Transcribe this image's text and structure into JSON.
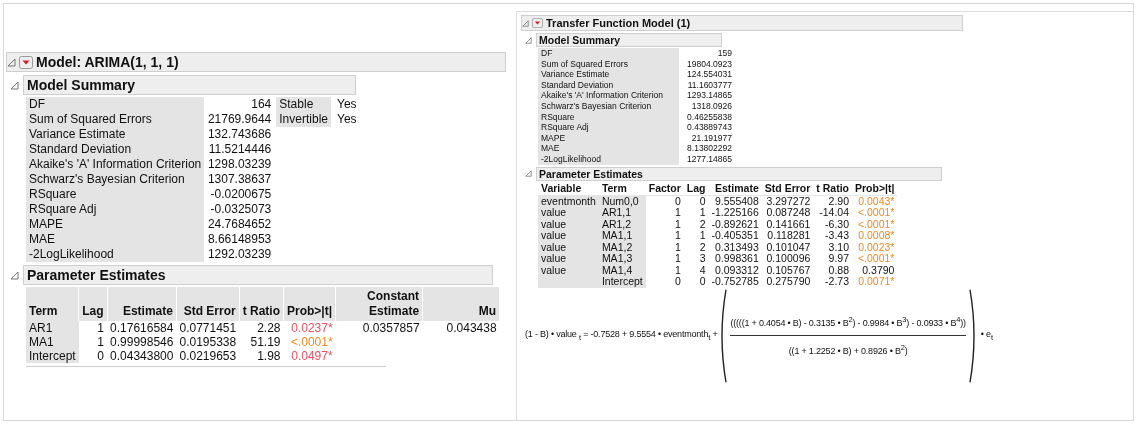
{
  "arima": {
    "title": "Model: ARIMA(1, 1, 1)",
    "summary": {
      "title": "Model Summary",
      "rows": [
        {
          "label": "DF",
          "value": "164"
        },
        {
          "label": "Sum of Squared Errors",
          "value": "21769.9644"
        },
        {
          "label": "Variance Estimate",
          "value": "132.743686"
        },
        {
          "label": "Standard Deviation",
          "value": "11.5214446"
        },
        {
          "label": "Akaike's 'A' Information Criterion",
          "value": "1298.03239"
        },
        {
          "label": "Schwarz's Bayesian Criterion",
          "value": "1307.38637"
        },
        {
          "label": "RSquare",
          "value": "-0.0200675"
        },
        {
          "label": "RSquare Adj",
          "value": "-0.0325073"
        },
        {
          "label": "MAPE",
          "value": "24.7684652"
        },
        {
          "label": "MAE",
          "value": "8.66148953"
        },
        {
          "label": "-2LogLikelihood",
          "value": "1292.03239"
        }
      ],
      "flags": [
        {
          "label": "Stable",
          "value": "Yes"
        },
        {
          "label": "Invertible",
          "value": "Yes"
        }
      ]
    },
    "params": {
      "title": "Parameter Estimates",
      "columns": [
        "Term",
        "Lag",
        "Estimate",
        "Std Error",
        "t Ratio",
        "Prob>|t|",
        "Constant Estimate",
        "Mu"
      ],
      "rows": [
        {
          "term": "AR1",
          "lag": "1",
          "estimate": "0.17616584",
          "std_error": "0.0771451",
          "t_ratio": "2.28",
          "prob": "0.0237*",
          "color": "#f04e5e",
          "constant_estimate": "0.0357857",
          "mu": "0.043438"
        },
        {
          "term": "MA1",
          "lag": "1",
          "estimate": "0.99998546",
          "std_error": "0.0195338",
          "t_ratio": "51.19",
          "prob": "<.0001*",
          "color": "#f08a24"
        },
        {
          "term": "Intercept",
          "lag": "0",
          "estimate": "0.04343800",
          "std_error": "0.0219653",
          "t_ratio": "1.98",
          "prob": "0.0497*",
          "color": "#f04e5e"
        }
      ]
    }
  },
  "transfer": {
    "title": "Transfer Function Model (1)",
    "summary": {
      "title": "Model Summary",
      "rows": [
        {
          "label": "DF",
          "value": "159"
        },
        {
          "label": "Sum of Squared Errors",
          "value": "19804.0923"
        },
        {
          "label": "Variance Estimate",
          "value": "124.554031"
        },
        {
          "label": "Standard Deviation",
          "value": "11.1603777"
        },
        {
          "label": "Akaike's 'A' Information Criterion",
          "value": "1293.14865"
        },
        {
          "label": "Schwarz's Bayesian Criterion",
          "value": "1318.0926"
        },
        {
          "label": "RSquare",
          "value": "0.46255838"
        },
        {
          "label": "RSquare Adj",
          "value": "0.43889743"
        },
        {
          "label": "MAPE",
          "value": "21.191977"
        },
        {
          "label": "MAE",
          "value": "8.13802292"
        },
        {
          "label": "-2LogLikelihood",
          "value": "1277.14865"
        }
      ]
    },
    "params": {
      "title": "Parameter Estimates",
      "columns": [
        "Variable",
        "Term",
        "Factor",
        "Lag",
        "Estimate",
        "Std Error",
        "t Ratio",
        "Prob>|t|"
      ],
      "rows": [
        {
          "variable": "eventmonth",
          "term": "Num0,0",
          "factor": "0",
          "lag": "0",
          "estimate": "9.555408",
          "std_error": "3.297272",
          "t_ratio": "2.90",
          "prob": "0.0043*",
          "color": "#f08a24"
        },
        {
          "variable": "value",
          "term": "AR1,1",
          "factor": "1",
          "lag": "1",
          "estimate": "-1.225166",
          "std_error": "0.087248",
          "t_ratio": "-14.04",
          "prob": "<.0001*",
          "color": "#f08a24"
        },
        {
          "variable": "value",
          "term": "AR1,2",
          "factor": "1",
          "lag": "2",
          "estimate": "-0.892621",
          "std_error": "0.141661",
          "t_ratio": "-6.30",
          "prob": "<.0001*",
          "color": "#f08a24"
        },
        {
          "variable": "value",
          "term": "MA1,1",
          "factor": "1",
          "lag": "1",
          "estimate": "-0.405351",
          "std_error": "0.118281",
          "t_ratio": "-3.43",
          "prob": "0.0008*",
          "color": "#f08a24"
        },
        {
          "variable": "value",
          "term": "MA1,2",
          "factor": "1",
          "lag": "2",
          "estimate": "0.313493",
          "std_error": "0.101047",
          "t_ratio": "3.10",
          "prob": "0.0023*",
          "color": "#f08a24"
        },
        {
          "variable": "value",
          "term": "MA1,3",
          "factor": "1",
          "lag": "3",
          "estimate": "0.998361",
          "std_error": "0.100096",
          "t_ratio": "9.97",
          "prob": "<.0001*",
          "color": "#f08a24"
        },
        {
          "variable": "value",
          "term": "MA1,4",
          "factor": "1",
          "lag": "4",
          "estimate": "0.093312",
          "std_error": "0.105767",
          "t_ratio": "0.88",
          "prob": "0.3790"
        },
        {
          "term": "Intercept",
          "factor": "0",
          "lag": "0",
          "estimate": "-0.752785",
          "std_error": "0.275790",
          "t_ratio": "-2.73",
          "prob": "0.0071*",
          "color": "#f08a24"
        }
      ]
    },
    "formula": {
      "lhs": "(1 - B) • value $_{t}$ = -0.7528 + 9.5554 • eventmonth$_{t}$ +",
      "numerator": "(((((1 + 0.4054 • B) - 0.3135 • B$^{2}$) - 0.9984 • B$^{3}$) - 0.0933 • B$^{4}$))",
      "denominator": "((1 + 1.2252 • B) + 0.8926 • B$^{2}$)",
      "tail": "• e$_{t}$"
    }
  }
}
